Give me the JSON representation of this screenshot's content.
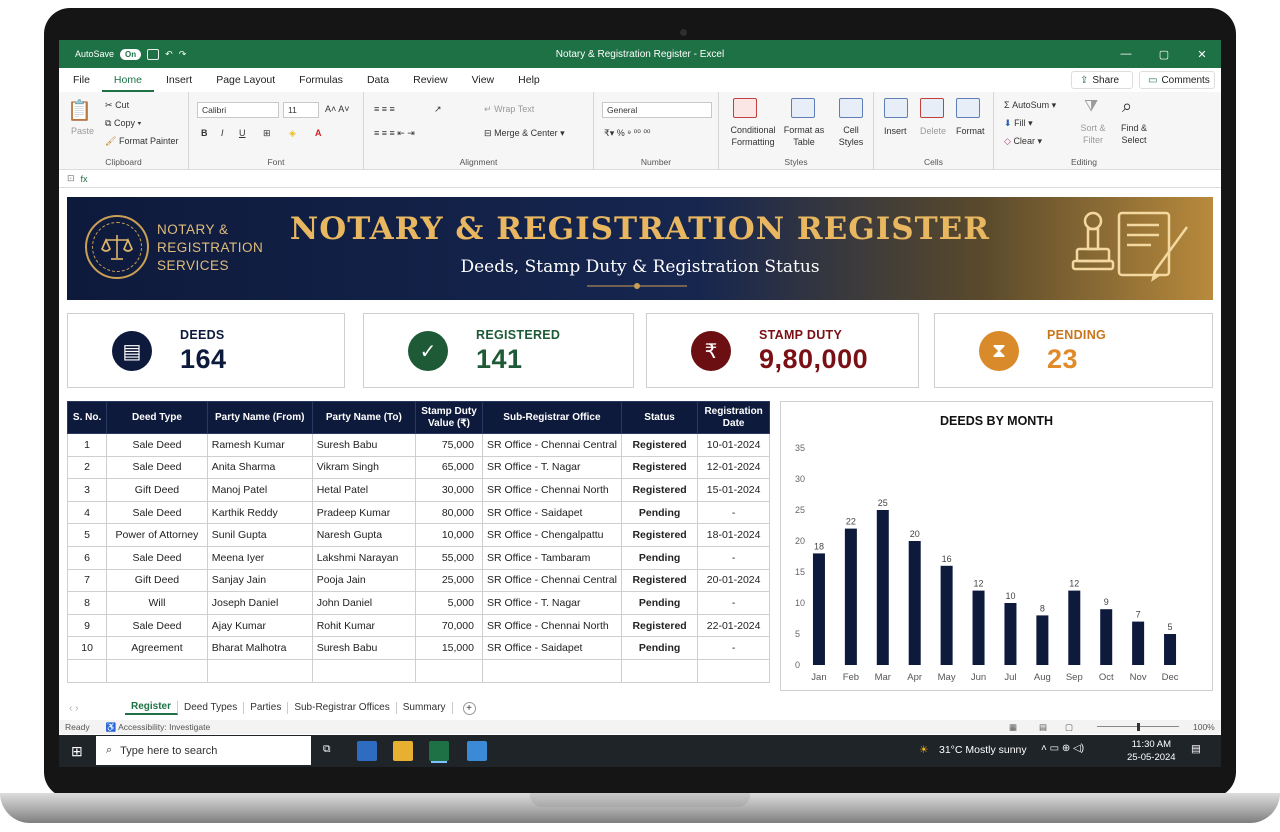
{
  "window": {
    "title": "Notary & Registration Register  -  Excel",
    "autosave_label": "AutoSave",
    "autosave_state": "On",
    "controls": [
      "—",
      "▢",
      "✕"
    ]
  },
  "menu": {
    "tabs": [
      "File",
      "Home",
      "Insert",
      "Page Layout",
      "Formulas",
      "Data",
      "Review",
      "View",
      "Help"
    ],
    "share": "Share",
    "comments": "Comments"
  },
  "ribbon": {
    "paste": "Paste",
    "cut": "Cut",
    "copy": "Copy",
    "format_painter": "Format Painter",
    "clipboard": "Clipboard",
    "font_name": "Calibri",
    "font_size": "11",
    "font_group": "Font",
    "wrap_text": "Wrap Text",
    "merge_center": "Merge & Center",
    "alignment": "Alignment",
    "number_format": "General",
    "number": "Number",
    "conditional_formatting": "Conditional Formatting",
    "format_as_table": "Format as Table",
    "cell_styles": "Cell Styles",
    "styles": "Styles",
    "insert": "Insert",
    "delete": "Delete",
    "format": "Format",
    "cells": "Cells",
    "autosum": "AutoSum",
    "fill": "Fill",
    "clear": "Clear",
    "sort_filter": "Sort & Filter",
    "find_select": "Find & Select",
    "editing": "Editing"
  },
  "banner": {
    "brand_line1": "NOTARY &",
    "brand_line2": "REGISTRATION",
    "brand_line3": "SERVICES",
    "title": "NOTARY & REGISTRATION REGISTER",
    "subtitle": "Deeds, Stamp Duty & Registration Status"
  },
  "kpis": [
    {
      "label": "DEEDS",
      "value": "164",
      "icon": "document-icon",
      "color": "#0e1a3c"
    },
    {
      "label": "REGISTERED",
      "value": "141",
      "icon": "check-icon",
      "color": "#1e5a36"
    },
    {
      "label": "STAMP DUTY",
      "value": "9,80,000",
      "icon": "rupee-icon",
      "color": "#6b0f12"
    },
    {
      "label": "PENDING",
      "value": "23",
      "icon": "hourglass-icon",
      "color": "#d98a2a"
    }
  ],
  "table": {
    "headers": [
      "S. No.",
      "Deed Type",
      "Party Name (From)",
      "Party Name (To)",
      "Stamp Duty Value (₹)",
      "Sub-Registrar Office",
      "Status",
      "Registration Date"
    ],
    "rows": [
      [
        "1",
        "Sale Deed",
        "Ramesh Kumar",
        "Suresh Babu",
        "75,000",
        "SR Office - Chennai Central",
        "Registered",
        "10-01-2024"
      ],
      [
        "2",
        "Sale Deed",
        "Anita Sharma",
        "Vikram Singh",
        "65,000",
        "SR Office - T. Nagar",
        "Registered",
        "12-01-2024"
      ],
      [
        "3",
        "Gift Deed",
        "Manoj Patel",
        "Hetal Patel",
        "30,000",
        "SR Office - Chennai North",
        "Registered",
        "15-01-2024"
      ],
      [
        "4",
        "Sale Deed",
        "Karthik Reddy",
        "Pradeep Kumar",
        "80,000",
        "SR Office - Saidapet",
        "Pending",
        "-"
      ],
      [
        "5",
        "Power of Attorney",
        "Sunil Gupta",
        "Naresh Gupta",
        "10,000",
        "SR Office - Chengalpattu",
        "Registered",
        "18-01-2024"
      ],
      [
        "6",
        "Sale Deed",
        "Meena Iyer",
        "Lakshmi Narayan",
        "55,000",
        "SR Office - Tambaram",
        "Pending",
        "-"
      ],
      [
        "7",
        "Gift Deed",
        "Sanjay Jain",
        "Pooja Jain",
        "25,000",
        "SR Office - Chennai Central",
        "Registered",
        "20-01-2024"
      ],
      [
        "8",
        "Will",
        "Joseph Daniel",
        "John Daniel",
        "5,000",
        "SR Office - T. Nagar",
        "Pending",
        "-"
      ],
      [
        "9",
        "Sale Deed",
        "Ajay Kumar",
        "Rohit Kumar",
        "70,000",
        "SR Office - Chennai North",
        "Registered",
        "22-01-2024"
      ],
      [
        "10",
        "Agreement",
        "Bharat Malhotra",
        "Suresh Babu",
        "15,000",
        "SR Office - Saidapet",
        "Pending",
        "-"
      ]
    ]
  },
  "chart_data": {
    "type": "bar",
    "title": "DEEDS BY MONTH",
    "categories": [
      "Jan",
      "Feb",
      "Mar",
      "Apr",
      "May",
      "Jun",
      "Jul",
      "Aug",
      "Sep",
      "Oct",
      "Nov",
      "Dec"
    ],
    "values": [
      18,
      22,
      25,
      20,
      16,
      12,
      10,
      8,
      12,
      9,
      7,
      5
    ],
    "ylim": [
      0,
      35
    ],
    "yticks": [
      0,
      5,
      10,
      15,
      20,
      25,
      30,
      35
    ],
    "bar_color": "#0e1a3c",
    "grid": false,
    "legend": "none"
  },
  "sheets": {
    "tabs": [
      "Register",
      "Deed Types",
      "Parties",
      "Sub-Registrar Offices",
      "Summary"
    ],
    "add": "+"
  },
  "status": {
    "ready": "Ready",
    "accessibility": "Accessibility: Investigate",
    "zoom": "100%"
  },
  "taskbar": {
    "search_placeholder": "Type here to search",
    "weather": "31°C  Mostly sunny",
    "time": "11:30 AM",
    "date": "25-05-2024"
  },
  "colors": {
    "excel_green": "#1e7145",
    "navy": "#0e1a3c",
    "gold": "#e8b760",
    "registered": "#1e7a32",
    "pending": "#e09020"
  }
}
